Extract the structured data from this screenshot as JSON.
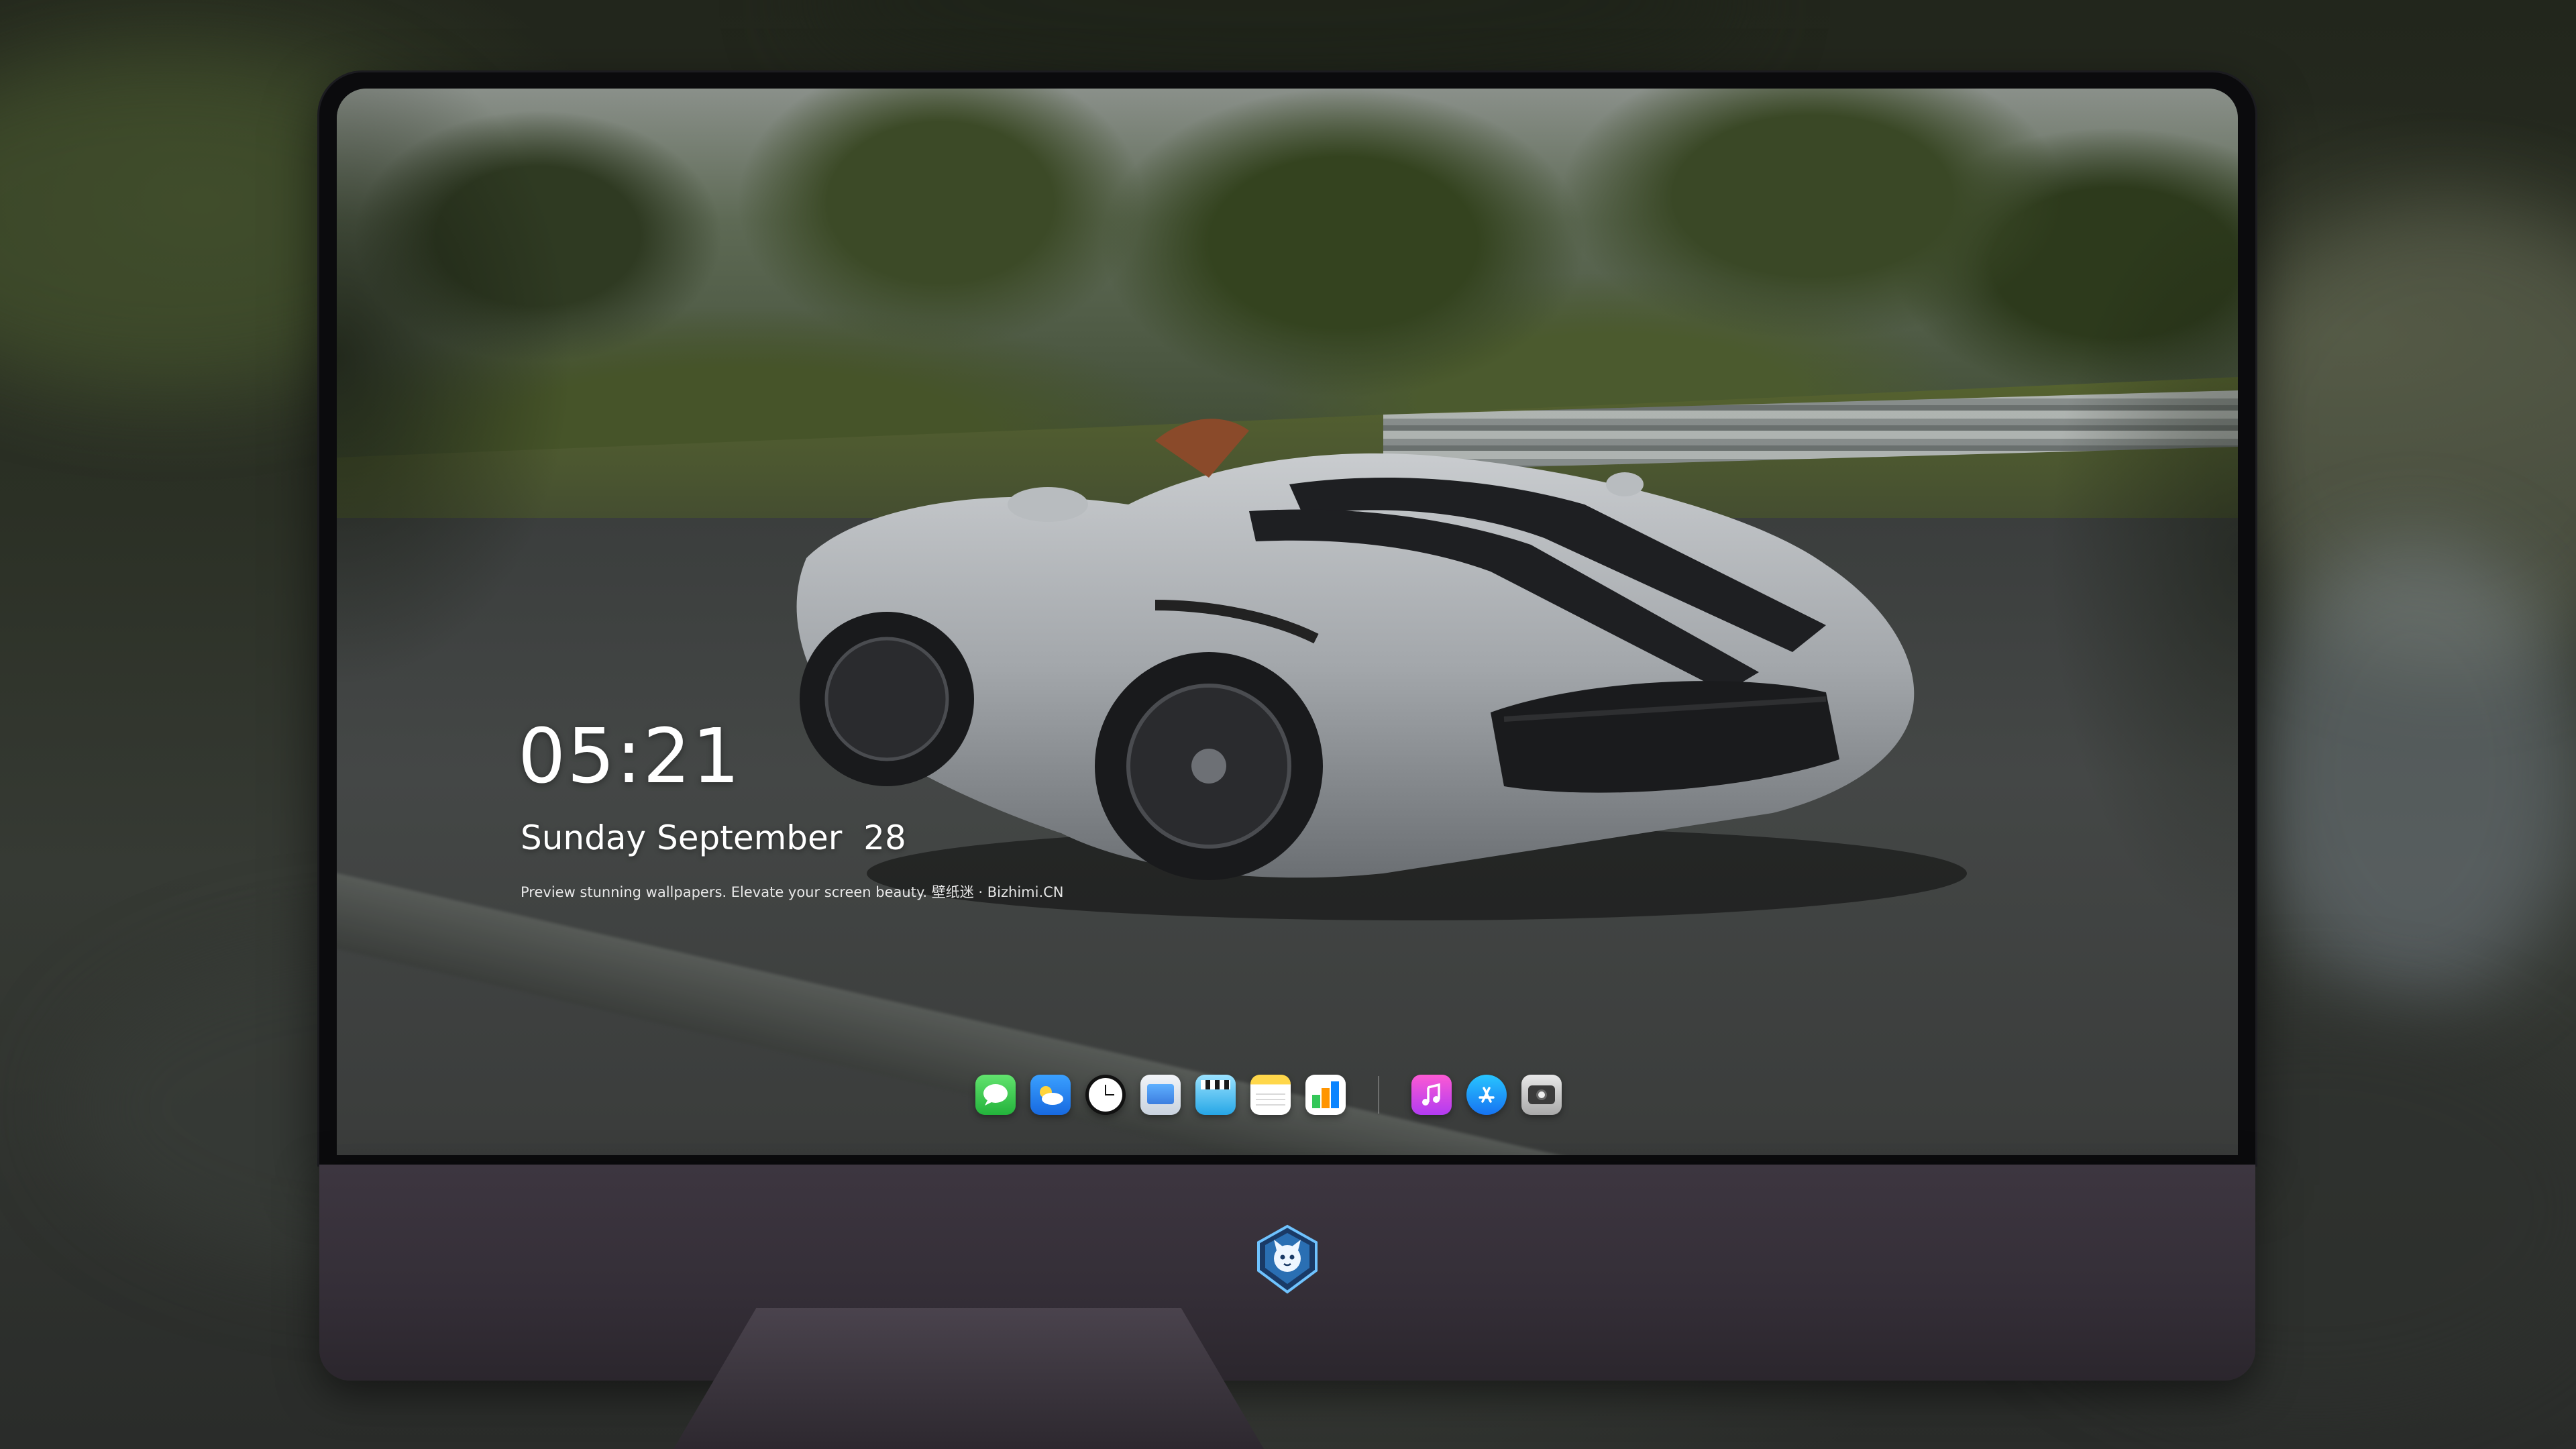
{
  "lock_screen": {
    "time": "05:21",
    "date": "Sunday September  28",
    "tagline": "Preview stunning wallpapers. Elevate your screen beauty. 壁纸迷 · Bizhimi.CN"
  },
  "dock": {
    "apps": [
      {
        "name": "Messages",
        "icon": "messages-icon"
      },
      {
        "name": "Weather",
        "icon": "weather-icon"
      },
      {
        "name": "Clock",
        "icon": "clock-icon"
      },
      {
        "name": "Preview",
        "icon": "preview-icon"
      },
      {
        "name": "Clips",
        "icon": "clips-icon"
      },
      {
        "name": "Notes",
        "icon": "notes-icon"
      },
      {
        "name": "Numbers",
        "icon": "numbers-icon"
      },
      {
        "name": "Music",
        "icon": "music-icon"
      },
      {
        "name": "App Store",
        "icon": "app-store-icon"
      },
      {
        "name": "Camera",
        "icon": "camera-icon"
      }
    ]
  },
  "wallpaper": {
    "subject": "silver speedster car with black racing stripes",
    "colors": {
      "car_body": "#a7abaf",
      "stripe": "#1e1f22",
      "road": "#414443"
    }
  },
  "monitor": {
    "chin_color": "#3d3640",
    "brand_logo_icon": "shield-cat-logo-icon"
  }
}
